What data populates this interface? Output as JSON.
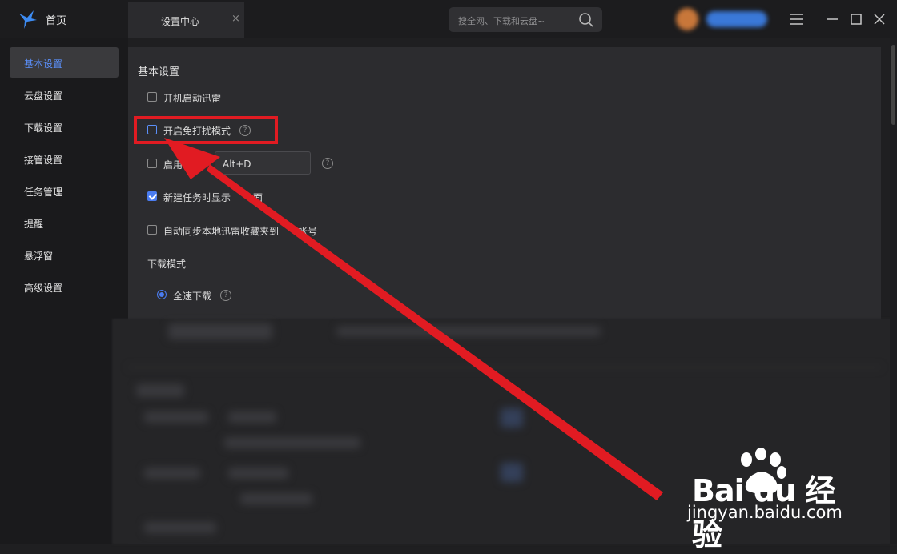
{
  "titlebar": {
    "home_label": "首页",
    "tab_label": "设置中心",
    "tab_close": "×",
    "search_placeholder": "搜全网、下载和云盘~"
  },
  "sidebar": {
    "items": [
      {
        "label": "基本设置",
        "active": true
      },
      {
        "label": "云盘设置"
      },
      {
        "label": "下载设置"
      },
      {
        "label": "接管设置"
      },
      {
        "label": "任务管理"
      },
      {
        "label": "提醒"
      },
      {
        "label": "悬浮窗"
      },
      {
        "label": "高级设置"
      }
    ]
  },
  "main": {
    "section_title": "基本设置",
    "options": [
      {
        "label": "开机启动迅雷",
        "checked": false
      },
      {
        "label": "开启免打扰模式",
        "checked": false,
        "help": "?"
      },
      {
        "label": "启用",
        "checked": false,
        "hotkey": "Alt+D",
        "help": "?"
      },
      {
        "label": "新建任务时显示",
        "label_end": "面",
        "checked": true
      },
      {
        "label": "自动同步本地迅雷收藏夹到",
        "label_end": "帐号",
        "checked": false
      }
    ],
    "download_mode_title": "下载模式",
    "download_mode_option": "全速下载",
    "download_mode_help": "?"
  },
  "watermark": {
    "brand": "Bai  du 经验",
    "url": "jingyan.baidu.com"
  },
  "colors": {
    "accent": "#4a7cf0",
    "annotation_red": "#e11b22"
  }
}
